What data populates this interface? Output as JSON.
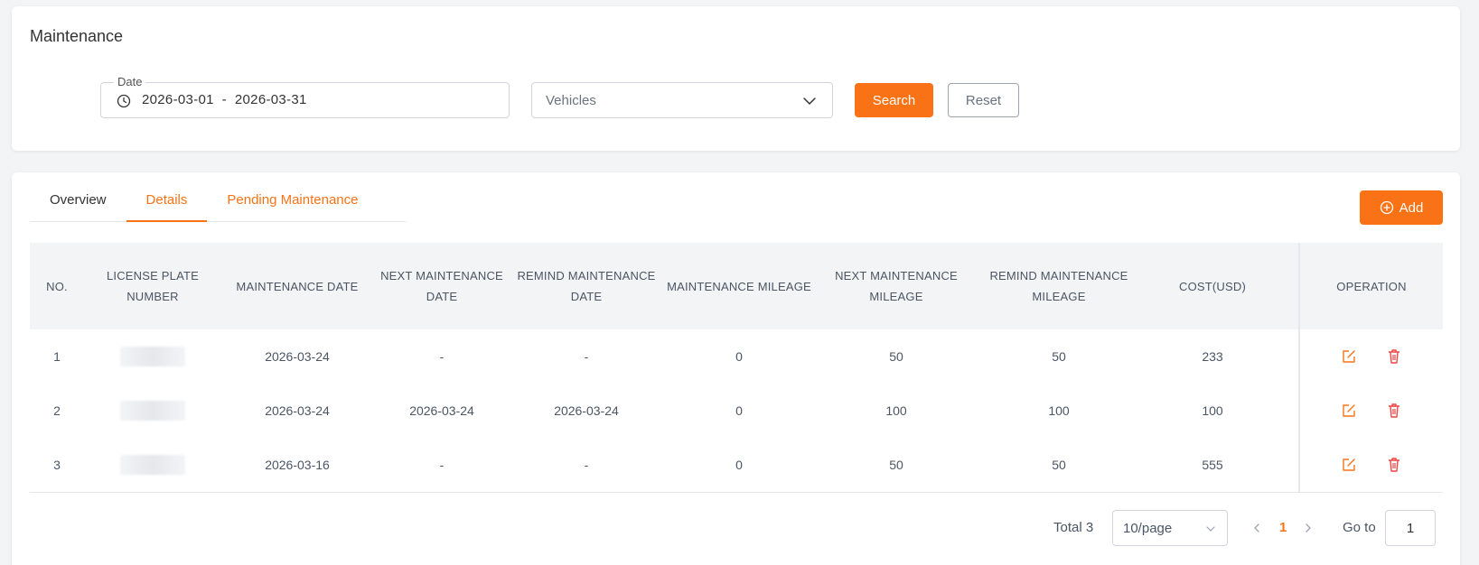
{
  "page": {
    "title": "Maintenance"
  },
  "filters": {
    "date_label": "Date",
    "date_range": "2026-03-01  -  2026-03-31",
    "vehicles_placeholder": "Vehicles",
    "search_label": "Search",
    "reset_label": "Reset"
  },
  "tabs": [
    {
      "label": "Overview",
      "active": false
    },
    {
      "label": "Details",
      "active": true
    },
    {
      "label": "Pending Maintenance",
      "active": false
    }
  ],
  "add_label": "Add",
  "table": {
    "headers": [
      "NO.",
      "LICENSE PLATE NUMBER",
      "MAINTENANCE DATE",
      "NEXT MAINTENANCE DATE",
      "REMIND MAINTENANCE DATE",
      "MAINTENANCE MILEAGE",
      "NEXT MAINTENANCE MILEAGE",
      "REMIND MAINTENANCE MILEAGE",
      "COST(USD)",
      "",
      "OPERATION"
    ],
    "rows": [
      {
        "no": "1",
        "plate": "",
        "maint_date": "2026-03-24",
        "next_date": "-",
        "remind_date": "-",
        "mileage": "0",
        "next_mileage": "50",
        "remind_mileage": "50",
        "cost": "233"
      },
      {
        "no": "2",
        "plate": "",
        "maint_date": "2026-03-24",
        "next_date": "2026-03-24",
        "remind_date": "2026-03-24",
        "mileage": "0",
        "next_mileage": "100",
        "remind_mileage": "100",
        "cost": "100"
      },
      {
        "no": "3",
        "plate": "",
        "maint_date": "2026-03-16",
        "next_date": "-",
        "remind_date": "-",
        "mileage": "0",
        "next_mileage": "50",
        "remind_mileage": "50",
        "cost": "555"
      }
    ]
  },
  "pagination": {
    "total": "Total 3",
    "page_size": "10/page",
    "current_page": "1",
    "goto_label": "Go to",
    "goto_value": "1"
  },
  "colors": {
    "accent": "#f97316",
    "delete": "#ef4444",
    "header_bg": "#f3f4f6"
  },
  "icons": {
    "date": "clock-icon",
    "select": "chevron-down-icon",
    "add": "plus-circle-icon",
    "edit": "edit-icon",
    "delete": "trash-icon"
  }
}
